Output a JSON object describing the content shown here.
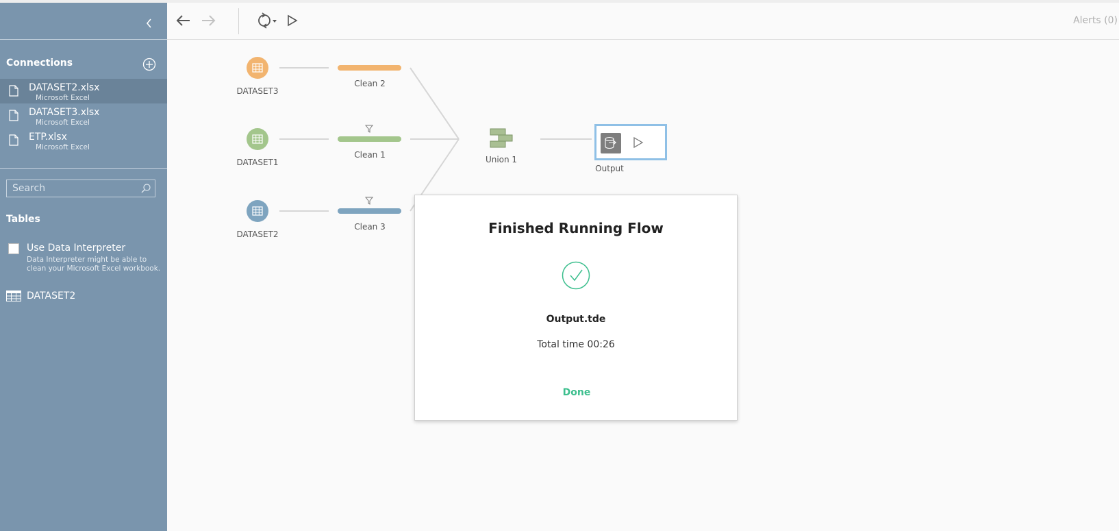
{
  "sidebar": {
    "connections_title": "Connections",
    "connections": [
      {
        "name": "DATASET2.xlsx",
        "type": "Microsoft Excel"
      },
      {
        "name": "DATASET3.xlsx",
        "type": "Microsoft Excel"
      },
      {
        "name": "ETP.xlsx",
        "type": "Microsoft Excel"
      }
    ],
    "search": {
      "placeholder": "Search",
      "value": ""
    },
    "tables_title": "Tables",
    "data_interpreter": {
      "label": "Use Data Interpreter",
      "description": "Data Interpreter might be able to clean your Microsoft Excel workbook.",
      "checked": false
    },
    "tables": [
      {
        "name": "DATASET2"
      }
    ]
  },
  "toolbar": {
    "alerts_label": "Alerts (0)"
  },
  "flow": {
    "inputs": [
      {
        "label": "DATASET3",
        "color": "#f2b46f"
      },
      {
        "label": "DATASET1",
        "color": "#a3c68c"
      },
      {
        "label": "DATASET2",
        "color": "#7ea4bf"
      }
    ],
    "cleans": [
      {
        "label": "Clean 2",
        "color": "#f2b46f",
        "filter": false
      },
      {
        "label": "Clean 1",
        "color": "#a3c68c",
        "filter": true
      },
      {
        "label": "Clean 3",
        "color": "#7ea4bf",
        "filter": true
      }
    ],
    "union_label": "Union 1",
    "output_label": "Output"
  },
  "dialog": {
    "title": "Finished Running Flow",
    "file": "Output.tde",
    "time": "Total time 00:26",
    "done_label": "Done"
  },
  "colors": {
    "sidebar_bg": "#7a95ad",
    "accent_green": "#3dbf8e",
    "output_border": "#8fc0e6"
  }
}
